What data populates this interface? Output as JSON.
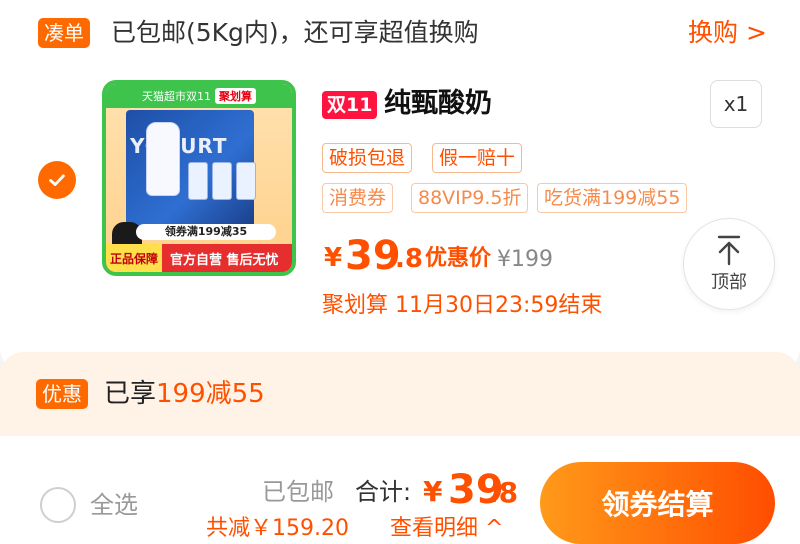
{
  "banner": {
    "tag": "凑单",
    "text": "已包邮(5Kg内)，还可享超值换购",
    "link": "换购 >"
  },
  "product": {
    "image": {
      "top_text": "天猫超市双11",
      "top_badge": "聚划算",
      "box_text": "YOGURT",
      "coupon_text": "领券满199减35",
      "footer_left": "正品保障",
      "footer_right": "官方自营 售后无忧"
    },
    "event_tag": "双11",
    "title": "纯甄酸奶",
    "quantity": "x1",
    "service_tags": [
      "破损包退",
      "假一赔十"
    ],
    "promo_tags": [
      "消费券",
      "88VIP9.5折",
      "吃货满199减55"
    ],
    "price_yen": "¥",
    "price_main": "39",
    "price_dec": ".8",
    "price_label": "优惠价",
    "original_price": "¥199",
    "deadline": "聚划算 11月30日23:59结束"
  },
  "back_to_top": {
    "label": "顶部"
  },
  "discount": {
    "tag": "优惠",
    "prefix": "已享",
    "value": "199减55"
  },
  "bottom": {
    "select_all": "全选",
    "shipped": "已包邮",
    "total_label": "合计:",
    "total_yen": "¥",
    "total_main": "39",
    "total_dec": ".8",
    "saved": "共减￥159.20",
    "detail_link": "查看明细 ^",
    "checkout": "领券结算"
  },
  "colors": {
    "accent": "#ff5000",
    "tag_orange": "#ff6a00",
    "double11_red": "#ff1440"
  }
}
